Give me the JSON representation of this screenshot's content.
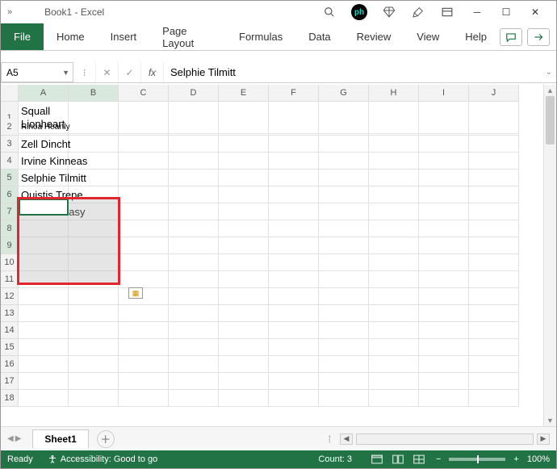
{
  "window": {
    "title": "Book1  -  Excel"
  },
  "ribbon": {
    "file": "File",
    "tabs": [
      "Home",
      "Insert",
      "Page Layout",
      "Formulas",
      "Data",
      "Review",
      "View",
      "Help"
    ]
  },
  "name_box": "A5",
  "formula_bar": "Selphie Tilmitt",
  "columns": [
    "A",
    "B",
    "C",
    "D",
    "E",
    "F",
    "G",
    "H",
    "I",
    "J"
  ],
  "row_numbers": [
    "1",
    "2",
    "3",
    "4",
    "5",
    "6",
    "7",
    "8",
    "9",
    "10",
    "11",
    "12",
    "13",
    "14",
    "15",
    "16",
    "17",
    "18"
  ],
  "cells": {
    "A1": "Squall Lionheart",
    "A2": "Rinoa Heartly",
    "A3": "Zell Dincht",
    "A4": "Irvine Kinneas",
    "A5": "Selphie Tilmitt",
    "A6": "Quistis Trepe",
    "A7": "Seifer Almasy"
  },
  "selection": {
    "range": "A5:B9",
    "active": "A5"
  },
  "sheet_tabs": {
    "active": "Sheet1"
  },
  "status": {
    "state": "Ready",
    "accessibility": "Accessibility: Good to go",
    "count_label": "Count: 3",
    "zoom": "100%"
  }
}
